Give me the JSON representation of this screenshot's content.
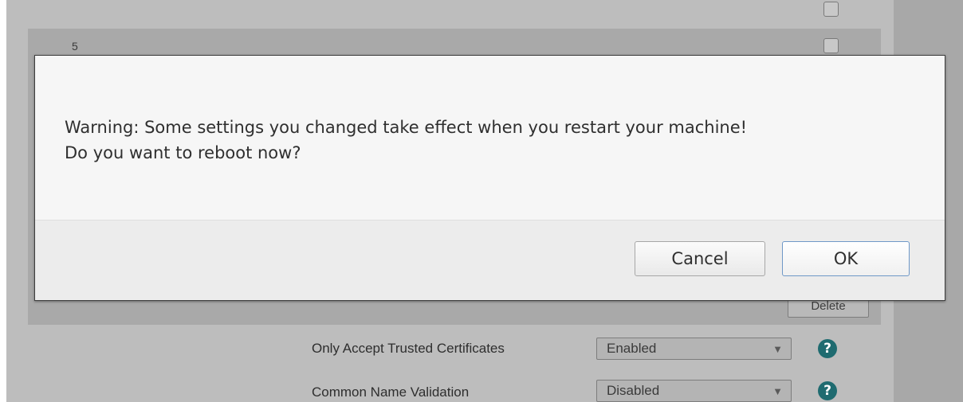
{
  "background": {
    "rows": [
      {
        "number": "5"
      }
    ],
    "delete_label": "Delete",
    "settings": [
      {
        "label": "Only Accept Trusted Certificates",
        "value": "Enabled"
      },
      {
        "label": "Common Name Validation",
        "value": "Disabled"
      }
    ],
    "dropdown_arrow": "▼",
    "help_glyph": "?"
  },
  "dialog": {
    "message_line1": "Warning: Some settings you changed take effect when you restart your machine!",
    "message_line2": "Do you want to reboot now?",
    "cancel_label": "Cancel",
    "ok_label": "OK"
  },
  "colors": {
    "help_icon": "#1f6b70",
    "ok_border": "#6f98c7"
  }
}
